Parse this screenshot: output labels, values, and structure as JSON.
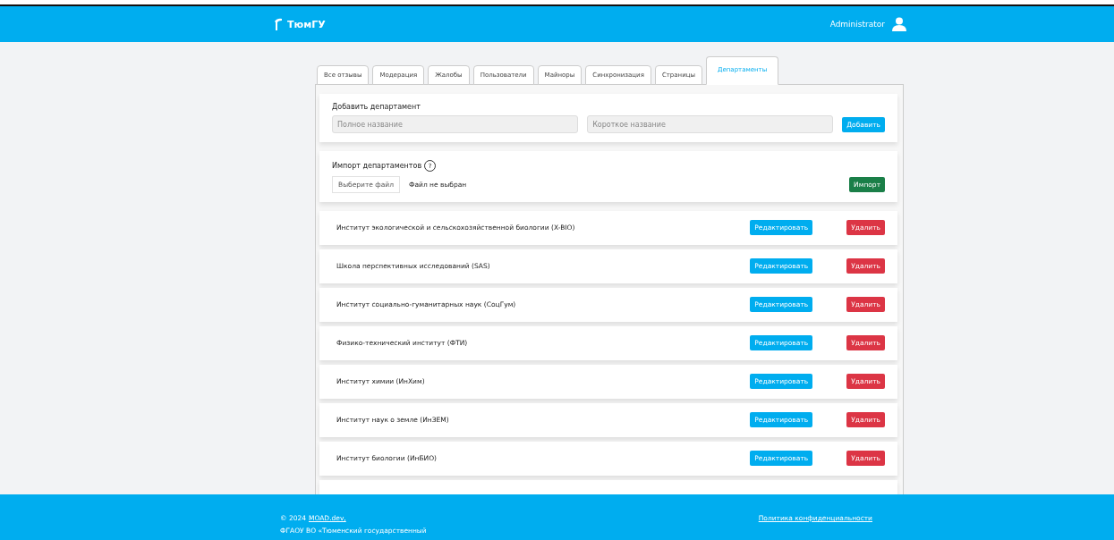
{
  "header": {
    "logo": "ТюмГУ",
    "user": "Administrator"
  },
  "tabs": [
    {
      "label": "Все отзывы",
      "selected": false
    },
    {
      "label": "Модерация",
      "selected": false
    },
    {
      "label": "Жалобы",
      "selected": false
    },
    {
      "label": "Пользователи",
      "selected": false
    },
    {
      "label": "Майноры",
      "selected": false
    },
    {
      "label": "Синхронизация",
      "selected": false
    },
    {
      "label": "Страницы",
      "selected": false
    },
    {
      "label": "Департаменты",
      "selected": true
    }
  ],
  "add_form": {
    "title": "Добавить департамент",
    "full_name": {
      "placeholder": "Полное название"
    },
    "short_name": {
      "placeholder": "Короткое название"
    },
    "button": "Добавить"
  },
  "import_form": {
    "title": "Импорт департаментов",
    "help": "?",
    "file_button": "Выберите файл",
    "file_status": "Файл не выбран",
    "button": "Импорт"
  },
  "departments": [
    {
      "name": "Институт экологической и сельскохозяйственной биологии (X-BIO)",
      "edit": "Редактировать",
      "delete": "Удалить"
    },
    {
      "name": "Школа перспективных исследований (SAS)",
      "edit": "Редактировать",
      "delete": "Удалить"
    },
    {
      "name": "Институт социально-гуманитарных наук (СоцГум)",
      "edit": "Редактировать",
      "delete": "Удалить"
    },
    {
      "name": "Физико-технический институт (ФТИ)",
      "edit": "Редактировать",
      "delete": "Удалить"
    },
    {
      "name": "Институт химии (ИнХим)",
      "edit": "Редактировать",
      "delete": "Удалить"
    },
    {
      "name": "Институт наук о земле (ИнЗЕМ)",
      "edit": "Редактировать",
      "delete": "Удалить"
    },
    {
      "name": "Институт биологии (ИнБИО)",
      "edit": "Редактировать",
      "delete": "Удалить"
    }
  ],
  "footer": {
    "copyright_prefix": "© 2024",
    "copyright_link": "MOAD.dev,",
    "org": "ФГАОУ ВО «Тюменский государственный",
    "privacy_link": "Политика конфиденциальности"
  }
}
